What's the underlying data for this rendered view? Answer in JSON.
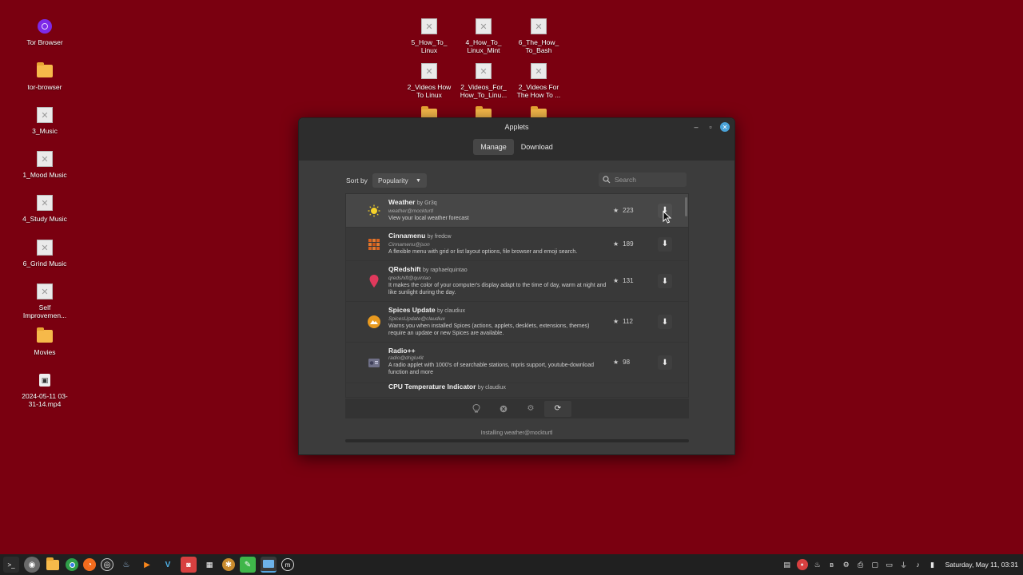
{
  "desktop": {
    "left_icons": [
      {
        "label": "Tor Browser",
        "icon": "tor-icon"
      },
      {
        "label": "tor-browser",
        "icon": "folder-icon"
      },
      {
        "label": "3_Music",
        "icon": "broken-link-icon"
      },
      {
        "label": "1_Mood Music",
        "icon": "broken-link-icon"
      },
      {
        "label": "4_Study Music",
        "icon": "broken-link-icon"
      },
      {
        "label": "6_Grind Music",
        "icon": "broken-link-icon"
      },
      {
        "label": "Self Improvemen...",
        "icon": "broken-link-icon"
      },
      {
        "label": "Movies",
        "icon": "folder-icon"
      },
      {
        "label": "2024-05-11 03-31-14.mp4",
        "icon": "video-file-icon"
      }
    ],
    "top_icons": [
      {
        "label": "5_How_To_ Linux",
        "icon": "broken-link-icon"
      },
      {
        "label": "4_How_To_ Linux_Mint",
        "icon": "broken-link-icon"
      },
      {
        "label": "6_The_How_ To_Bash",
        "icon": "broken-link-icon"
      },
      {
        "label": "2_Videos How To Linux",
        "icon": "broken-link-icon"
      },
      {
        "label": "2_Videos_For_ How_To_Linu...",
        "icon": "broken-link-icon"
      },
      {
        "label": "2_Videos For The How To ...",
        "icon": "broken-link-icon"
      }
    ]
  },
  "window": {
    "title": "Applets",
    "tabs": [
      {
        "label": "Manage",
        "active": false
      },
      {
        "label": "Download",
        "active": true
      }
    ],
    "sort_label": "Sort by",
    "sort_value": "Popularity",
    "search_placeholder": "Search",
    "applets": [
      {
        "name": "Weather",
        "author": "by Gr3q",
        "uuid": "weather@mockturtl",
        "description": "View your local weather forecast",
        "score": "223",
        "icon": "sun-icon"
      },
      {
        "name": "Cinnamenu",
        "author": "by fredcw",
        "uuid": "Cinnamenu@json",
        "description": "A flexible menu with grid or list layout options, file browser and emoji search.",
        "score": "189",
        "icon": "grid-menu-icon"
      },
      {
        "name": "QRedshift",
        "author": "by raphaelquintao",
        "uuid": "qredshift@quintao",
        "description": "It makes the color of your computer's display adapt to the time of day, warm at night and like sunlight during the day.",
        "score": "131",
        "icon": "pin-icon"
      },
      {
        "name": "Spices Update",
        "author": "by claudiux",
        "uuid": "SpicesUpdate@claudiux",
        "description": "Warns you when installed Spices (actions, applets, desklets, extensions, themes) require an update or new Spices are available.",
        "score": "112",
        "icon": "spices-icon"
      },
      {
        "name": "Radio++",
        "author": "by claudiux",
        "uuid": "radio@driglu4it",
        "description": "A radio applet with 1000's of searchable stations, mpris support, youtube-download function and more",
        "score": "98",
        "icon": "radio-icon"
      },
      {
        "name": "CPU Temperature Indicator",
        "author": "by claudiux",
        "uuid": "",
        "description": "",
        "score": "",
        "icon": "thermometer-icon"
      }
    ],
    "status": "Installing weather@mockturtl",
    "progress": 0.0
  },
  "taskbar": {
    "clock": "Saturday, May 11, 03:31"
  }
}
